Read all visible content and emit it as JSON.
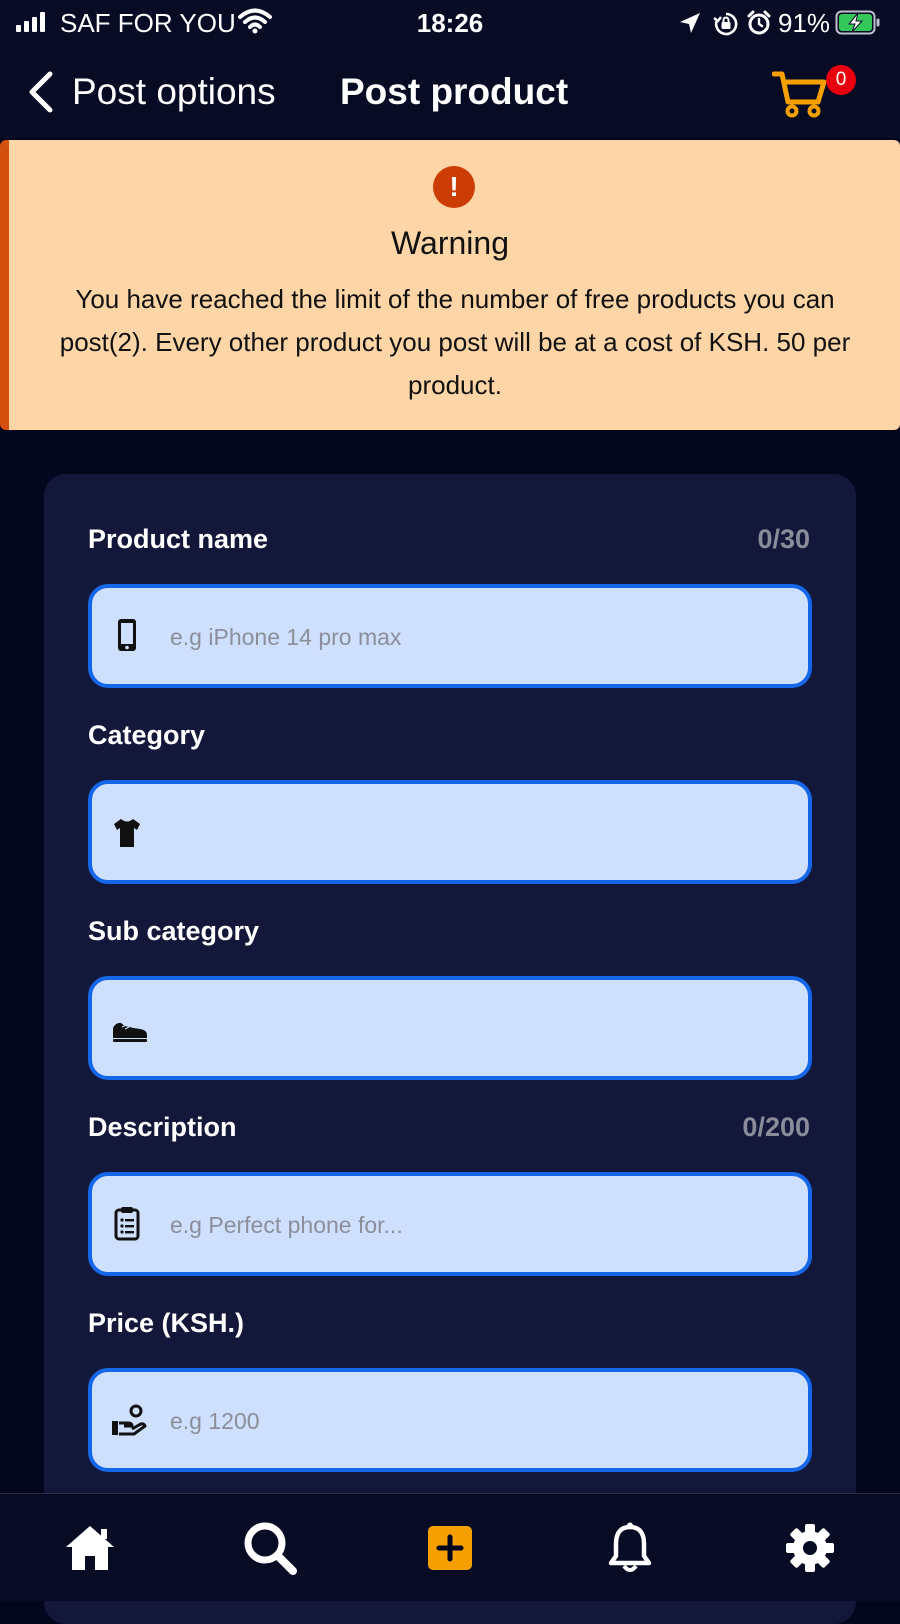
{
  "status_bar": {
    "carrier": "SAF FOR YOU",
    "time": "18:26",
    "battery_percent": "91%",
    "icons": [
      "signal-icon",
      "wifi-icon",
      "location-arrow-icon",
      "rotation-lock-icon",
      "alarm-icon",
      "battery-charging-icon"
    ]
  },
  "header": {
    "back_label": "Post options",
    "title": "Post product",
    "cart_count": "0",
    "cart_color": "#f5a000"
  },
  "warning": {
    "title": "Warning",
    "message": "You have reached the limit of the number of free products you can post(2). Every other product you post will be at a cost of KSH. 50 per product.",
    "accent_color": "#d4500e",
    "background_color": "#fdd5a6"
  },
  "form": {
    "product_name": {
      "label": "Product name",
      "counter": "0/30",
      "placeholder": "e.g iPhone 14 pro max",
      "value": "",
      "icon": "phone-icon"
    },
    "category": {
      "label": "Category",
      "placeholder": "",
      "value": "",
      "icon": "tshirt-icon"
    },
    "sub_category": {
      "label": "Sub category",
      "placeholder": "",
      "value": "",
      "icon": "shoe-icon"
    },
    "description": {
      "label": "Description",
      "counter": "0/200",
      "placeholder": "e.g Perfect phone for...",
      "value": "",
      "icon": "clipboard-icon"
    },
    "price": {
      "label": "Price (KSH.)",
      "placeholder": "e.g 1200",
      "value": "",
      "icon": "hand-money-icon"
    }
  },
  "tabbar": {
    "items": [
      "home-icon",
      "search-icon",
      "add-post-icon",
      "notifications-icon",
      "settings-icon"
    ],
    "active_accent": "#f5a000"
  }
}
